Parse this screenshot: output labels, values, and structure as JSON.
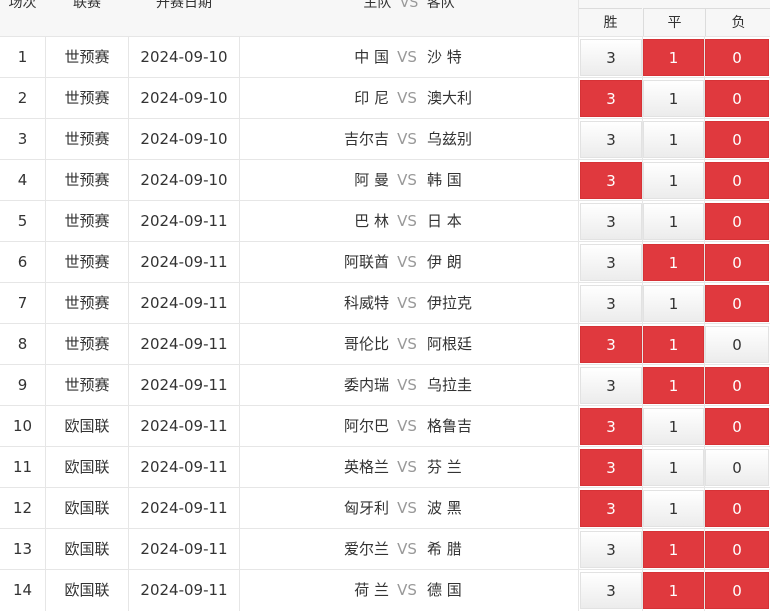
{
  "header": {
    "col_no": "场次",
    "col_league": "联赛",
    "col_date": "开赛日期",
    "col_home": "主队",
    "col_vs": "VS",
    "col_away": "客队",
    "win": "胜",
    "draw": "平",
    "loss": "负"
  },
  "colors": {
    "highlight": "#e0393e",
    "vs": "#999999"
  },
  "rows": [
    {
      "no": "1",
      "league": "世预赛",
      "date": "2024-09-10",
      "home": "中 国",
      "away": "沙 特",
      "win": "3",
      "draw": "1",
      "loss": "0",
      "hit": [
        false,
        true,
        true
      ]
    },
    {
      "no": "2",
      "league": "世预赛",
      "date": "2024-09-10",
      "home": "印 尼",
      "away": "澳大利",
      "win": "3",
      "draw": "1",
      "loss": "0",
      "hit": [
        true,
        false,
        true
      ]
    },
    {
      "no": "3",
      "league": "世预赛",
      "date": "2024-09-10",
      "home": "吉尔吉",
      "away": "乌兹别",
      "win": "3",
      "draw": "1",
      "loss": "0",
      "hit": [
        false,
        false,
        true
      ]
    },
    {
      "no": "4",
      "league": "世预赛",
      "date": "2024-09-10",
      "home": "阿 曼",
      "away": "韩 国",
      "win": "3",
      "draw": "1",
      "loss": "0",
      "hit": [
        true,
        false,
        true
      ]
    },
    {
      "no": "5",
      "league": "世预赛",
      "date": "2024-09-11",
      "home": "巴 林",
      "away": "日 本",
      "win": "3",
      "draw": "1",
      "loss": "0",
      "hit": [
        false,
        false,
        true
      ]
    },
    {
      "no": "6",
      "league": "世预赛",
      "date": "2024-09-11",
      "home": "阿联酋",
      "away": "伊 朗",
      "win": "3",
      "draw": "1",
      "loss": "0",
      "hit": [
        false,
        true,
        true
      ]
    },
    {
      "no": "7",
      "league": "世预赛",
      "date": "2024-09-11",
      "home": "科威特",
      "away": "伊拉克",
      "win": "3",
      "draw": "1",
      "loss": "0",
      "hit": [
        false,
        false,
        true
      ]
    },
    {
      "no": "8",
      "league": "世预赛",
      "date": "2024-09-11",
      "home": "哥伦比",
      "away": "阿根廷",
      "win": "3",
      "draw": "1",
      "loss": "0",
      "hit": [
        true,
        true,
        false
      ]
    },
    {
      "no": "9",
      "league": "世预赛",
      "date": "2024-09-11",
      "home": "委内瑞",
      "away": "乌拉圭",
      "win": "3",
      "draw": "1",
      "loss": "0",
      "hit": [
        false,
        true,
        true
      ]
    },
    {
      "no": "10",
      "league": "欧国联",
      "date": "2024-09-11",
      "home": "阿尔巴",
      "away": "格鲁吉",
      "win": "3",
      "draw": "1",
      "loss": "0",
      "hit": [
        true,
        false,
        true
      ]
    },
    {
      "no": "11",
      "league": "欧国联",
      "date": "2024-09-11",
      "home": "英格兰",
      "away": "芬 兰",
      "win": "3",
      "draw": "1",
      "loss": "0",
      "hit": [
        true,
        false,
        false
      ]
    },
    {
      "no": "12",
      "league": "欧国联",
      "date": "2024-09-11",
      "home": "匈牙利",
      "away": "波 黑",
      "win": "3",
      "draw": "1",
      "loss": "0",
      "hit": [
        true,
        false,
        true
      ]
    },
    {
      "no": "13",
      "league": "欧国联",
      "date": "2024-09-11",
      "home": "爱尔兰",
      "away": "希 腊",
      "win": "3",
      "draw": "1",
      "loss": "0",
      "hit": [
        false,
        true,
        true
      ]
    },
    {
      "no": "14",
      "league": "欧国联",
      "date": "2024-09-11",
      "home": "荷 兰",
      "away": "德 国",
      "win": "3",
      "draw": "1",
      "loss": "0",
      "hit": [
        false,
        true,
        true
      ]
    }
  ]
}
